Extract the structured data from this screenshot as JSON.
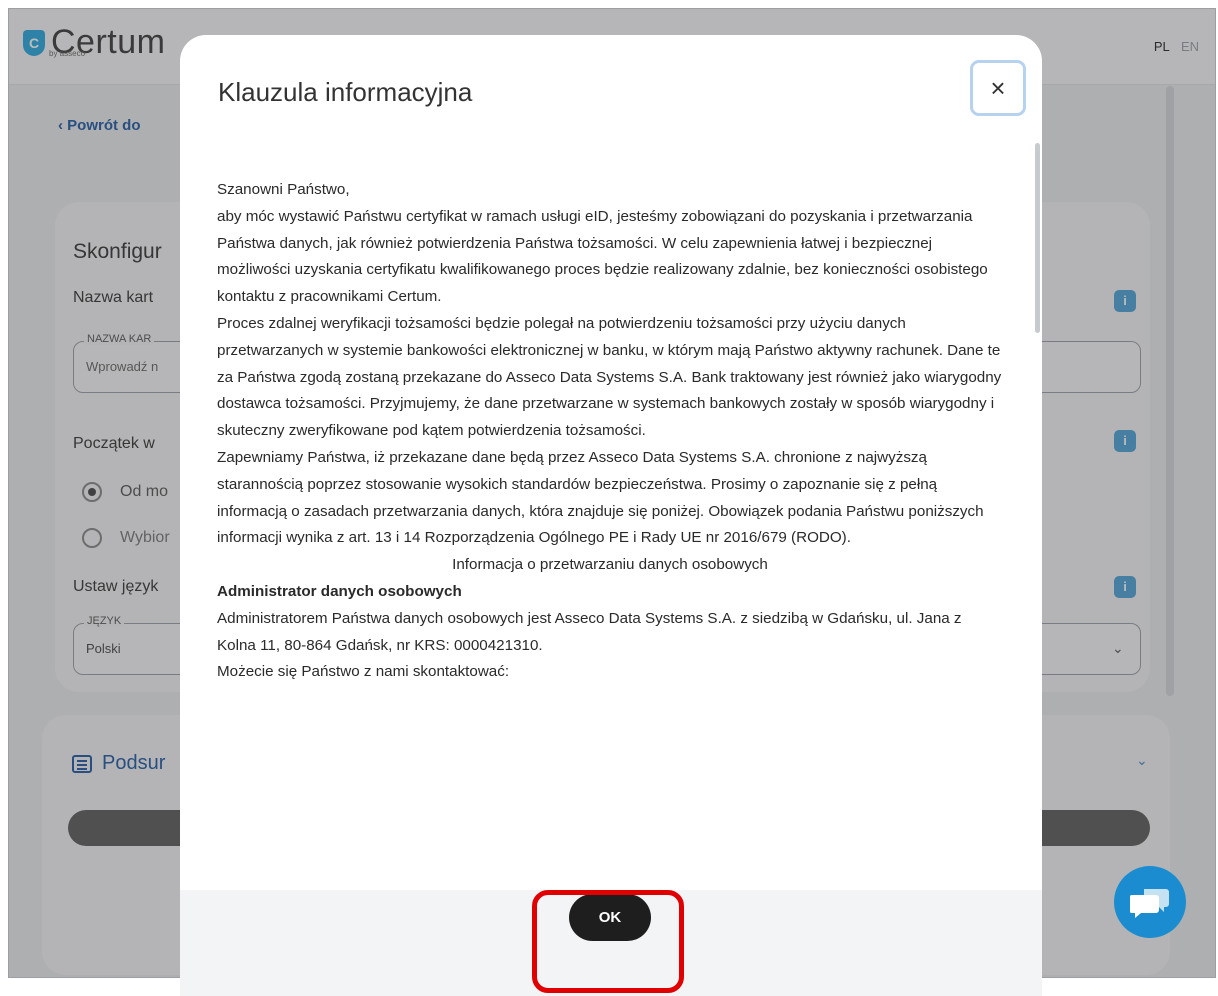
{
  "header": {
    "logo_text": "Certum",
    "logo_badge": "C",
    "logo_sub": "by asseco",
    "languages": [
      "PL",
      "EN"
    ]
  },
  "background": {
    "back_link": "‹  Powrót do",
    "card_title": "Skonfigur",
    "label_name": "Nazwa kart",
    "field_name_legend": "NAZWA KAR",
    "field_name_placeholder": "Wprowadź n",
    "label_start": "Początek w",
    "radio_1": "Od mo",
    "radio_2": "Wybior",
    "label_lang": "Ustaw język",
    "field_lang_legend": "JĘZYK",
    "field_lang_value": "Polski",
    "info_icon": "i",
    "summary_title": "Podsur"
  },
  "modal": {
    "title": "Klauzula informacyjna",
    "close_glyph": "×",
    "paragraphs": [
      "Szanowni Państwo,",
      "aby móc wystawić Państwu certyfikat w ramach usługi eID, jesteśmy zobowiązani do pozyskania i przetwarzania Państwa danych, jak również potwierdzenia Państwa tożsamości. W celu zapewnienia łatwej i bezpiecznej możliwości uzyskania certyfikatu kwalifikowanego proces będzie realizowany zdalnie, bez konieczności osobistego kontaktu z pracownikami Certum.",
      "Proces zdalnej weryfikacji tożsamości będzie polegał na potwierdzeniu tożsamości przy użyciu danych przetwarzanych w systemie bankowości elektronicznej w banku, w którym mają Państwo aktywny rachunek. Dane te za Państwa zgodą zostaną przekazane do Asseco Data Systems S.A. Bank traktowany jest również jako wiarygodny dostawca tożsamości. Przyjmujemy, że dane przetwarzane w systemach bankowych zostały w sposób wiarygodny i skuteczny zweryfikowane pod kątem potwierdzenia tożsamości.",
      "Zapewniamy Państwa, iż przekazane dane będą przez Asseco Data Systems S.A. chronione z najwyższą starannością poprzez stosowanie wysokich standardów bezpieczeństwa. Prosimy o zapoznanie się z pełną informacją o zasadach przetwarzania danych, która znajduje się poniżej. Obowiązek podania Państwu poniższych informacji wynika z art. 13 i 14 Rozporządzenia Ogólnego PE i Rady UE nr 2016/679 (RODO)."
    ],
    "section_title": "Informacja o przetwarzaniu danych osobowych",
    "admin_heading": "Administrator danych osobowych",
    "admin_paragraphs": [
      "Administratorem Państwa danych osobowych jest Asseco Data Systems S.A. z siedzibą w Gdańsku, ul. Jana z Kolna 11, 80-864 Gdańsk, nr KRS: 0000421310.",
      "Możecie się Państwo z nami skontaktować:"
    ],
    "ok_label": "OK"
  }
}
